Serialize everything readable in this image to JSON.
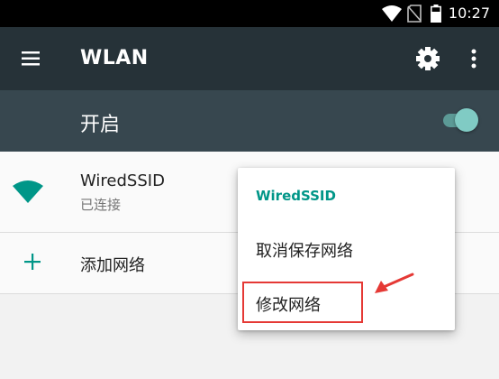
{
  "status_bar": {
    "time": "10:27"
  },
  "toolbar": {
    "title": "WLAN"
  },
  "switch_bar": {
    "label": "开启",
    "enabled": true
  },
  "networks": [
    {
      "ssid": "WiredSSID",
      "status": "已连接"
    }
  ],
  "add_network": {
    "label": "添加网络"
  },
  "context_menu": {
    "title": "WiredSSID",
    "items": [
      "取消保存网络",
      "修改网络"
    ]
  },
  "colors": {
    "accent": "#009688",
    "annotation": "#e53935",
    "toolbar": "#263238",
    "switch_bar": "#37474f"
  }
}
